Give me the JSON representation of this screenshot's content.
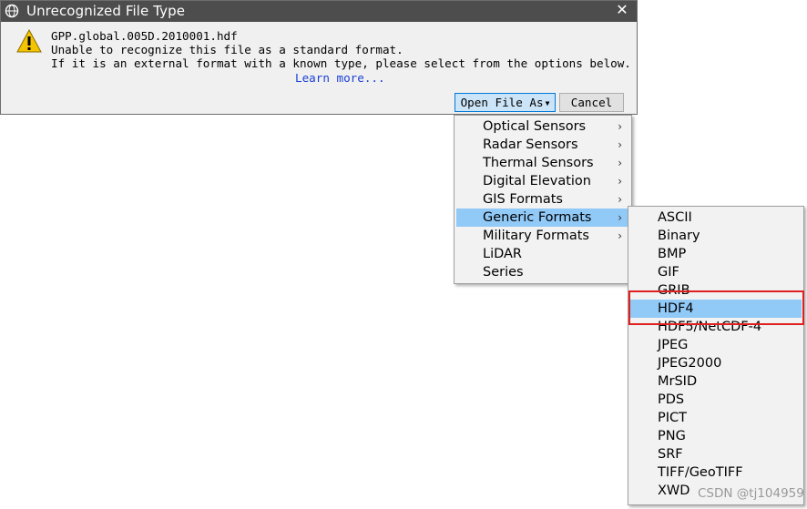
{
  "dialog": {
    "title": "Unrecognized File Type",
    "app_icon": "envi-globe-icon",
    "close_glyph": "✕",
    "warning_icon": "warning-triangle-icon",
    "filename": "GPP.global.005D.2010001.hdf",
    "line1": "Unable to recognize this file as a standard format.",
    "line2": "If it is an external format with a known type, please select from the options below.",
    "learn_more": "Learn more...",
    "open_button": "Open File As",
    "cancel_button": "Cancel"
  },
  "menu": {
    "items": [
      {
        "label": "Optical Sensors",
        "submenu": true
      },
      {
        "label": "Radar Sensors",
        "submenu": true
      },
      {
        "label": "Thermal Sensors",
        "submenu": true
      },
      {
        "label": "Digital Elevation",
        "submenu": true
      },
      {
        "label": "GIS Formats",
        "submenu": true
      },
      {
        "label": "Generic Formats",
        "submenu": true
      },
      {
        "label": "Military Formats",
        "submenu": true
      },
      {
        "label": "LiDAR",
        "submenu": false
      },
      {
        "label": "Series",
        "submenu": false
      }
    ],
    "highlighted": "Generic Formats"
  },
  "submenu": {
    "items": [
      "ASCII",
      "Binary",
      "BMP",
      "GIF",
      "GRIB",
      "HDF4",
      "HDF5/NetCDF-4",
      "JPEG",
      "JPEG2000",
      "MrSID",
      "PDS",
      "PICT",
      "PNG",
      "SRF",
      "TIFF/GeoTIFF",
      "XWD"
    ],
    "highlighted": "HDF4"
  },
  "colors": {
    "titlebar": "#4d4d4d",
    "highlight": "#91c9f7",
    "annotation_box": "#e02020",
    "link": "#1a3fd6"
  },
  "watermark": "CSDN @tj104959"
}
